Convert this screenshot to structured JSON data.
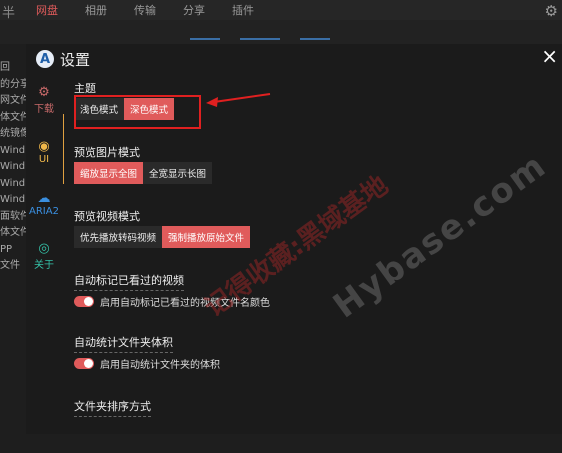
{
  "topbar": {
    "logo": "半",
    "tabs": [
      {
        "label": "网盘",
        "active": true
      },
      {
        "label": "相册",
        "active": false
      },
      {
        "label": "传输",
        "active": false
      },
      {
        "label": "分享",
        "active": false
      },
      {
        "label": "插件",
        "active": false
      }
    ]
  },
  "background_list": [
    "回",
    "的分享",
    "网文件",
    "体文件",
    "统镜像",
    "Wind",
    "Wind",
    "Wind",
    "Wind",
    "面软件",
    "体文件",
    "PP",
    "文件"
  ],
  "dialog": {
    "title": "设置",
    "close": "×",
    "sidebar": [
      {
        "label": "下载",
        "icon": "gear-icon"
      },
      {
        "label": "UI",
        "icon": "ui-icon"
      },
      {
        "label": "ARIA2",
        "icon": "cloud-icon"
      },
      {
        "label": "关于",
        "icon": "info-icon"
      }
    ],
    "theme": {
      "title": "主题",
      "options": [
        {
          "label": "浅色模式",
          "active": false
        },
        {
          "label": "深色模式",
          "active": true
        }
      ]
    },
    "image_preview": {
      "title": "预览图片模式",
      "options": [
        {
          "label": "缩放显示全图",
          "active": true
        },
        {
          "label": "全宽显示长图",
          "active": false
        }
      ]
    },
    "video_preview": {
      "title": "预览视频模式",
      "options": [
        {
          "label": "优先播放转码视频",
          "active": false
        },
        {
          "label": "强制播放原始文件",
          "active": true
        }
      ]
    },
    "auto_mark": {
      "title": "自动标记已看过的视频",
      "toggle_label": "启用自动标记已看过的视频文件名颜色",
      "enabled": true
    },
    "folder_size": {
      "title": "自动统计文件夹体积",
      "toggle_label": "启用自动统计文件夹的体积",
      "enabled": true
    },
    "sort": {
      "title": "文件夹排序方式"
    }
  },
  "watermark": {
    "text_cn": "记得收藏:黑域基地",
    "text_en": "Hybase.com"
  },
  "colors": {
    "accent": "#e05b5b",
    "annotation": "#e02020",
    "background": "#1e1e1e"
  }
}
